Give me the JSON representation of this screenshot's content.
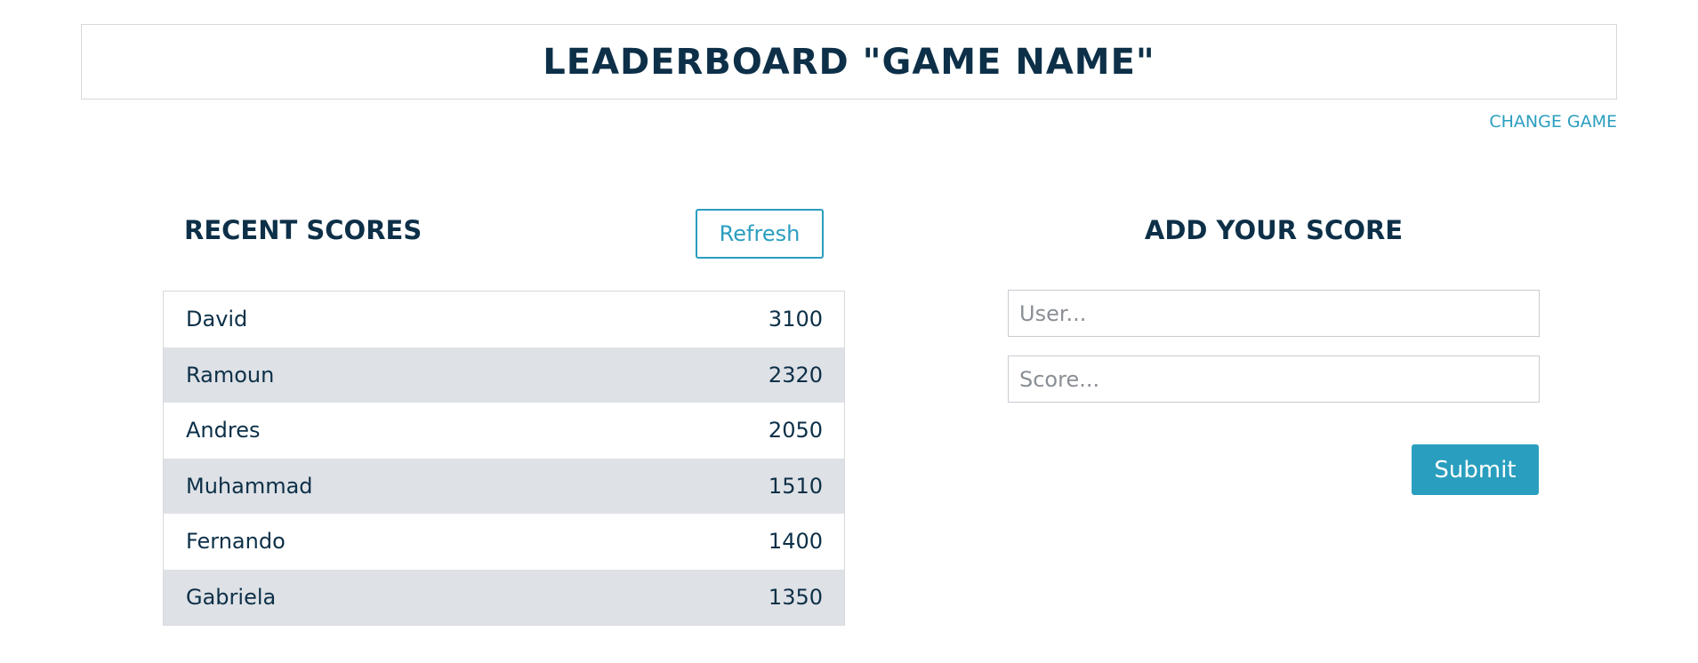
{
  "header": {
    "title": "LEADERBOARD \"GAME NAME\""
  },
  "nav": {
    "change_game": "CHANGE GAME"
  },
  "recent": {
    "title": "RECENT SCORES",
    "refresh_label": "Refresh",
    "rows": [
      {
        "name": "David",
        "score": "3100"
      },
      {
        "name": "Ramoun",
        "score": "2320"
      },
      {
        "name": "Andres",
        "score": "2050"
      },
      {
        "name": "Muhammad",
        "score": "1510"
      },
      {
        "name": "Fernando",
        "score": "1400"
      },
      {
        "name": "Gabriela",
        "score": "1350"
      }
    ]
  },
  "form": {
    "title": "ADD YOUR SCORE",
    "user_placeholder": "User...",
    "score_placeholder": "Score...",
    "submit_label": "Submit"
  },
  "colors": {
    "accent": "#2a9ebf",
    "text": "#0d3048",
    "stripe": "#dee1e6"
  }
}
